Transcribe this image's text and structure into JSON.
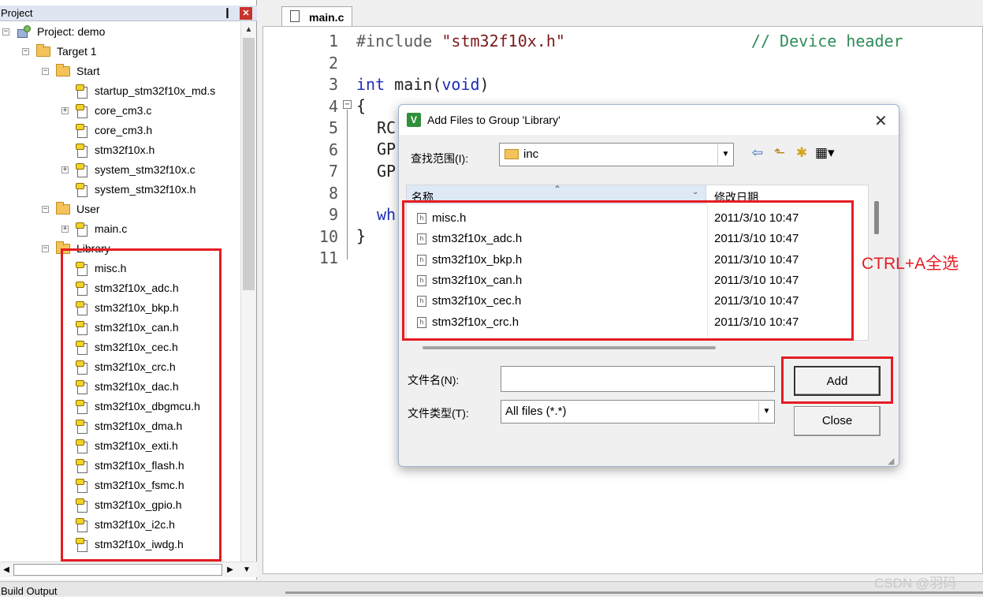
{
  "project_panel": {
    "title": "Project",
    "pin_glyph": "❙",
    "close_glyph": "✕",
    "tree": [
      {
        "label": "Project: demo",
        "level": 0,
        "kind": "project",
        "expander": "−"
      },
      {
        "label": "Target 1",
        "level": 1,
        "kind": "target",
        "expander": "−"
      },
      {
        "label": "Start",
        "level": 2,
        "kind": "folder",
        "expander": "−"
      },
      {
        "label": "startup_stm32f10x_md.s",
        "level": 3,
        "kind": "file",
        "expander": ""
      },
      {
        "label": "core_cm3.c",
        "level": 3,
        "kind": "file",
        "expander": "+"
      },
      {
        "label": "core_cm3.h",
        "level": 3,
        "kind": "file",
        "expander": ""
      },
      {
        "label": "stm32f10x.h",
        "level": 3,
        "kind": "file",
        "expander": ""
      },
      {
        "label": "system_stm32f10x.c",
        "level": 3,
        "kind": "file",
        "expander": "+"
      },
      {
        "label": "system_stm32f10x.h",
        "level": 3,
        "kind": "file",
        "expander": ""
      },
      {
        "label": "User",
        "level": 2,
        "kind": "folder",
        "expander": "−"
      },
      {
        "label": "main.c",
        "level": 3,
        "kind": "file",
        "expander": "+"
      },
      {
        "label": "Library",
        "level": 2,
        "kind": "folder",
        "expander": "−"
      },
      {
        "label": "misc.h",
        "level": 3,
        "kind": "file",
        "expander": ""
      },
      {
        "label": "stm32f10x_adc.h",
        "level": 3,
        "kind": "file",
        "expander": ""
      },
      {
        "label": "stm32f10x_bkp.h",
        "level": 3,
        "kind": "file",
        "expander": ""
      },
      {
        "label": "stm32f10x_can.h",
        "level": 3,
        "kind": "file",
        "expander": ""
      },
      {
        "label": "stm32f10x_cec.h",
        "level": 3,
        "kind": "file",
        "expander": ""
      },
      {
        "label": "stm32f10x_crc.h",
        "level": 3,
        "kind": "file",
        "expander": ""
      },
      {
        "label": "stm32f10x_dac.h",
        "level": 3,
        "kind": "file",
        "expander": ""
      },
      {
        "label": "stm32f10x_dbgmcu.h",
        "level": 3,
        "kind": "file",
        "expander": ""
      },
      {
        "label": "stm32f10x_dma.h",
        "level": 3,
        "kind": "file",
        "expander": ""
      },
      {
        "label": "stm32f10x_exti.h",
        "level": 3,
        "kind": "file",
        "expander": ""
      },
      {
        "label": "stm32f10x_flash.h",
        "level": 3,
        "kind": "file",
        "expander": ""
      },
      {
        "label": "stm32f10x_fsmc.h",
        "level": 3,
        "kind": "file",
        "expander": ""
      },
      {
        "label": "stm32f10x_gpio.h",
        "level": 3,
        "kind": "file",
        "expander": ""
      },
      {
        "label": "stm32f10x_i2c.h",
        "level": 3,
        "kind": "file",
        "expander": ""
      },
      {
        "label": "stm32f10x_iwdg.h",
        "level": 3,
        "kind": "file",
        "expander": ""
      }
    ]
  },
  "build_output": {
    "label": "Build Output"
  },
  "editor": {
    "tab": "main.c",
    "line_numbers": [
      "1",
      "2",
      "3",
      "4",
      "5",
      "6",
      "7",
      "8",
      "9",
      "10",
      "11"
    ],
    "code": {
      "l1_include": "#include",
      "l1_header": "\"stm32f10x.h\"",
      "l1_comment": "// Device header",
      "l3_int": "int",
      "l3_main": " main(",
      "l3_void": "void",
      "l3_close": ")",
      "l4": "{",
      "l5": "RC",
      "l6": "GP",
      "l7": "GP",
      "l9": "wh",
      "l10": "}"
    }
  },
  "dialog": {
    "title": "Add Files to Group 'Library'",
    "close_glyph": "✕",
    "look_in_label": "查找范围(I):",
    "look_in_value": "inc",
    "columns": {
      "name": "名称",
      "date": "修改日期"
    },
    "files": [
      {
        "name": "misc.h",
        "date": "2011/3/10 10:47"
      },
      {
        "name": "stm32f10x_adc.h",
        "date": "2011/3/10 10:47"
      },
      {
        "name": "stm32f10x_bkp.h",
        "date": "2011/3/10 10:47"
      },
      {
        "name": "stm32f10x_can.h",
        "date": "2011/3/10 10:47"
      },
      {
        "name": "stm32f10x_cec.h",
        "date": "2011/3/10 10:47"
      },
      {
        "name": "stm32f10x_crc.h",
        "date": "2011/3/10 10:47"
      }
    ],
    "file_name_label": "文件名(N):",
    "file_name_value": "",
    "file_type_label": "文件类型(T):",
    "file_type_value": "All files (*.*)",
    "add_button": "Add",
    "close_button": "Close"
  },
  "annotations": {
    "hint": "CTRL+A全选",
    "color": "#e51c23"
  },
  "watermark": "CSDN @羽码"
}
